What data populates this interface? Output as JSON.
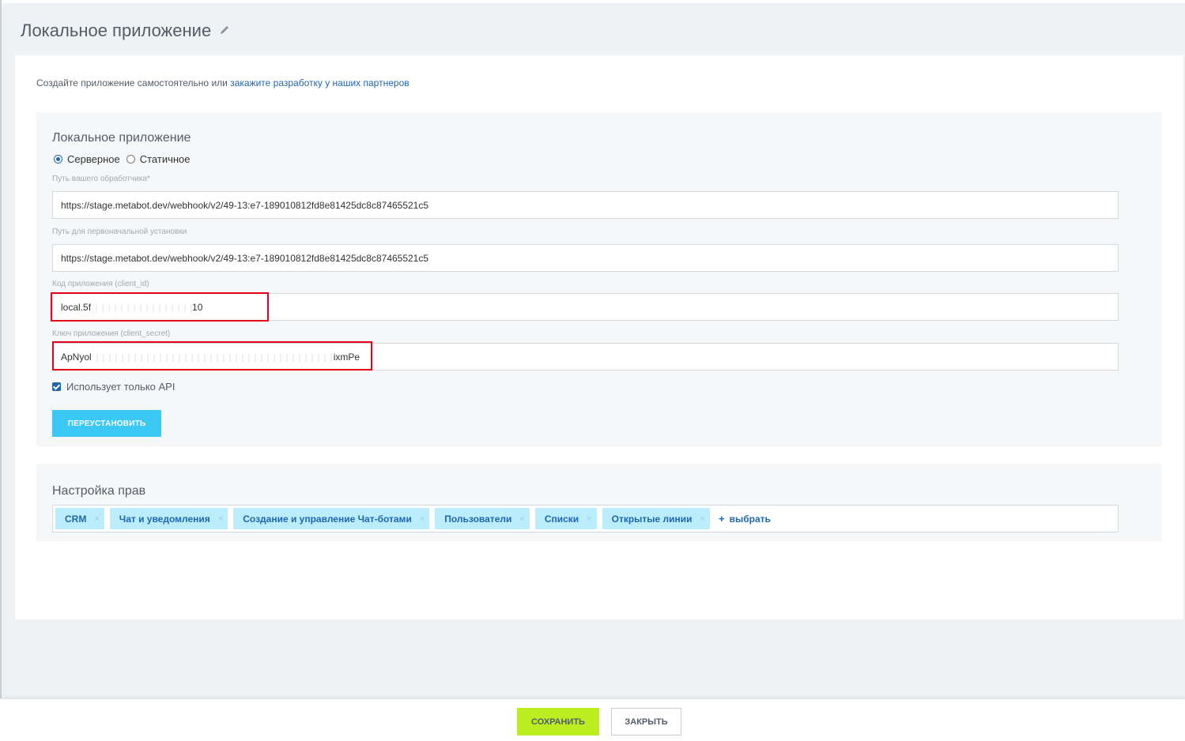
{
  "header": {
    "title": "Локальное приложение"
  },
  "intro": {
    "text": "Создайте приложение самостоятельно или ",
    "link": "закажите разработку у наших партнеров"
  },
  "app_panel": {
    "title": "Локальное приложение",
    "radio_server": "Серверное",
    "radio_static": "Статичное",
    "selected_type": "Серверное",
    "handler_label": "Путь вашего обработчика*",
    "handler_value": "https://stage.metabot.dev/webhook/v2/49-13:e7-189010812fd8e81425dc8c87465521c5",
    "install_label": "Путь для первоначальной установки",
    "install_value": "https://stage.metabot.dev/webhook/v2/49-13:e7-189010812fd8e81425dc8c87465521c5",
    "client_id_label": "Код приложения (client_id)",
    "client_id_prefix": "local.5f",
    "client_id_suffix": "10",
    "client_secret_label": "Ключ приложения (client_secret)",
    "client_secret_prefix": "ApNyol",
    "client_secret_suffix": "ixmPe",
    "api_only_label": "Использует только API",
    "api_only_checked": true,
    "reinstall_button": "ПЕРЕУСТАНОВИТЬ"
  },
  "rights_panel": {
    "title": "Настройка прав",
    "tags": [
      "CRM",
      "Чат и уведомления",
      "Создание и управление Чат-ботами",
      "Пользователи",
      "Списки",
      "Открытые линии"
    ],
    "choose_label": "выбрать",
    "remove_glyph": "×",
    "plus_glyph": "+"
  },
  "footer": {
    "save_button": "СОХРАНИТЬ",
    "close_button": "ЗАКРЫТЬ"
  },
  "colors": {
    "accent_blue": "#2067b0",
    "button_cyan": "#3bc8f5",
    "save_green": "#bbed21",
    "highlight_red": "#e3001b"
  }
}
